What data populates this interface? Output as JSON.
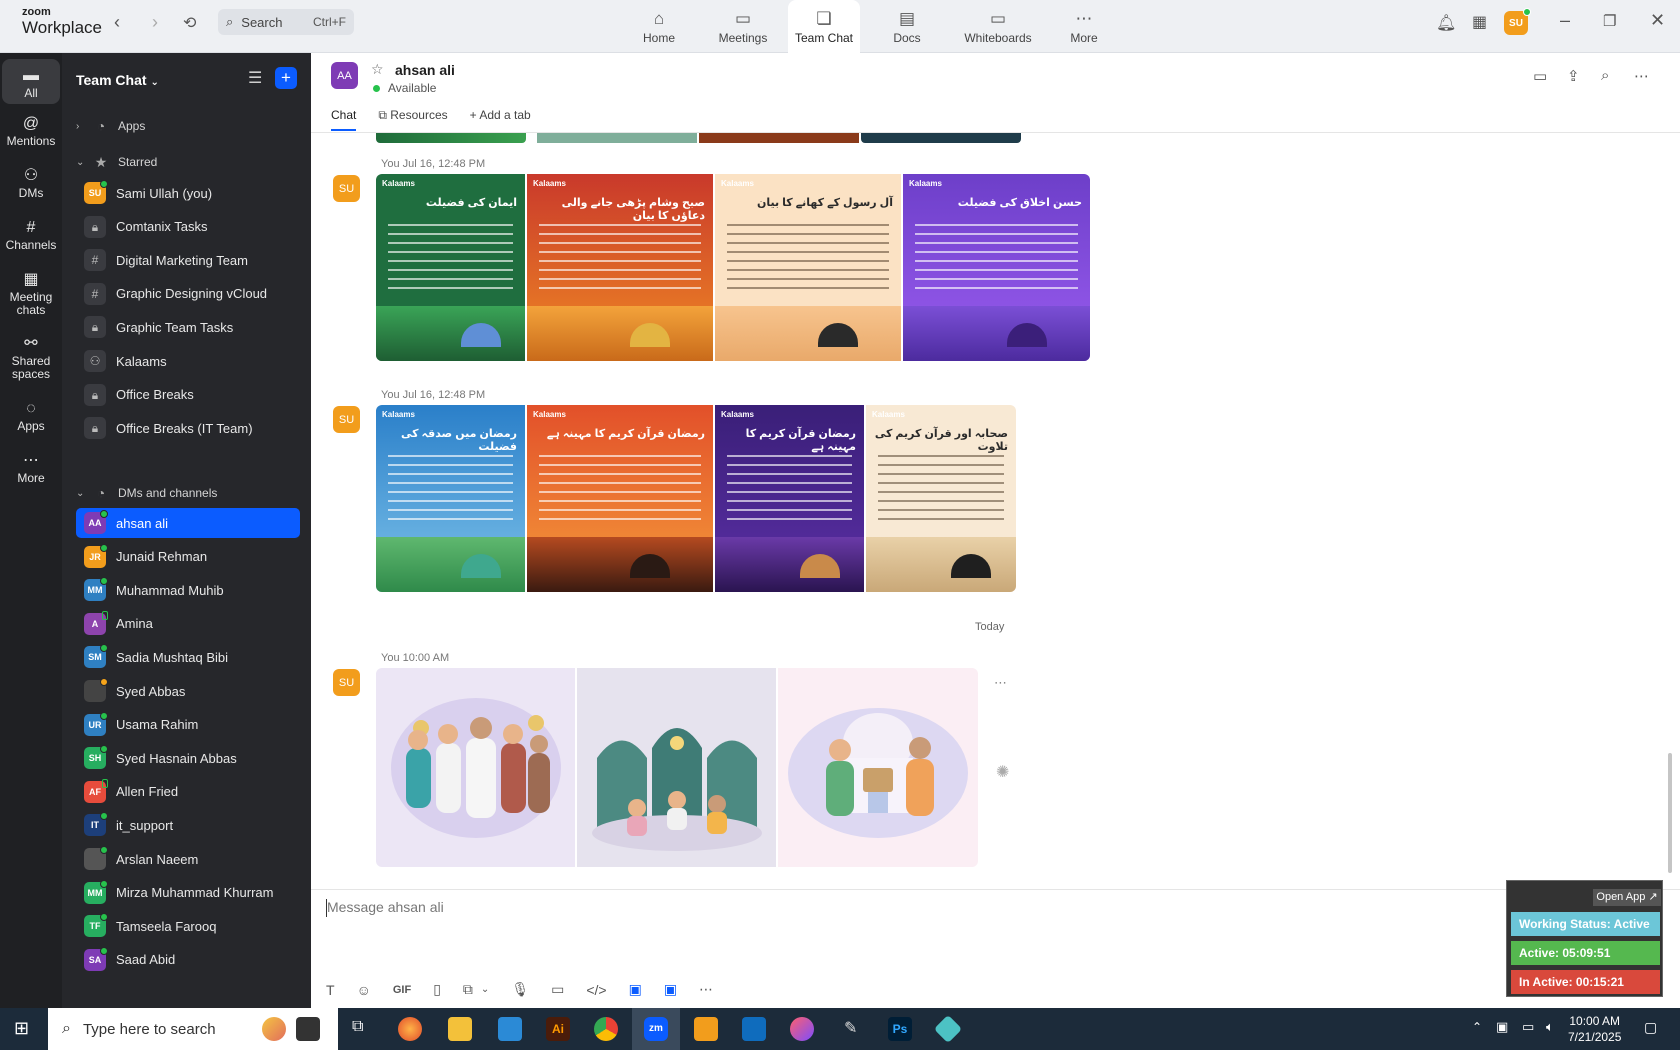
{
  "titlebar": {
    "brand_top": "zoom",
    "brand_bottom": "Workplace",
    "search_placeholder": "Search",
    "search_shortcut": "Ctrl+F",
    "nav": [
      {
        "label": "Home",
        "icon": "home-icon"
      },
      {
        "label": "Meetings",
        "icon": "video-icon"
      },
      {
        "label": "Team Chat",
        "icon": "chat-icon"
      },
      {
        "label": "Docs",
        "icon": "doc-icon"
      },
      {
        "label": "Whiteboards",
        "icon": "whiteboard-icon"
      },
      {
        "label": "More",
        "icon": "more-icon"
      }
    ],
    "user_initials": "SU"
  },
  "rail": [
    {
      "label": "All"
    },
    {
      "label": "Mentions"
    },
    {
      "label": "DMs"
    },
    {
      "label": "Channels"
    },
    {
      "label": "Meeting chats"
    },
    {
      "label": "Shared spaces"
    },
    {
      "label": "Apps"
    },
    {
      "label": "More"
    }
  ],
  "sidebar": {
    "title": "Team Chat",
    "apps_label": "Apps",
    "starred_label": "Starred",
    "starred": [
      {
        "name": "Sami Ullah (you)",
        "initials": "SU",
        "kind": "person",
        "color": "#f29d1c"
      },
      {
        "name": "Comtanix Tasks",
        "kind": "lock"
      },
      {
        "name": "Digital Marketing Team",
        "kind": "hash"
      },
      {
        "name": "Graphic Designing vCloud",
        "kind": "hash"
      },
      {
        "name": "Graphic Team Tasks",
        "kind": "lock"
      },
      {
        "name": "Kalaams",
        "kind": "group"
      },
      {
        "name": "Office Breaks",
        "kind": "lock"
      },
      {
        "name": "Office Breaks (IT Team)",
        "kind": "lock"
      }
    ],
    "dms_label": "DMs and channels",
    "dms": [
      {
        "name": "ahsan ali",
        "initials": "AA",
        "color": "#7e3bb5"
      },
      {
        "name": "Junaid Rehman",
        "initials": "JR",
        "color": "#f29d1c"
      },
      {
        "name": "Muhammad Muhib",
        "initials": "MM",
        "color": "#2f80c2"
      },
      {
        "name": "Amina",
        "initials": "A",
        "color": "#8e44ad"
      },
      {
        "name": "Sadia Mushtaq Bibi",
        "initials": "SM",
        "color": "#2f80c2"
      },
      {
        "name": "Syed Abbas",
        "initials": "",
        "color": "#444"
      },
      {
        "name": "Usama Rahim",
        "initials": "UR",
        "color": "#2f80c2"
      },
      {
        "name": "Syed Hasnain Abbas",
        "initials": "SH",
        "color": "#27ae60"
      },
      {
        "name": "Allen Fried",
        "initials": "AF",
        "color": "#e74c3c"
      },
      {
        "name": "it_support",
        "initials": "IT",
        "color": "#1d3f7a"
      },
      {
        "name": "Arslan Naeem",
        "initials": "",
        "color": "#555"
      },
      {
        "name": "Mirza Muhammad Khurram",
        "initials": "MM",
        "color": "#27ae60"
      },
      {
        "name": "Tamseela Farooq",
        "initials": "TF",
        "color": "#27ae60"
      },
      {
        "name": "Saad Abid",
        "initials": "SA",
        "color": "#7e3bb5"
      }
    ]
  },
  "chat": {
    "contact_initials": "AA",
    "contact_name": "ahsan ali",
    "contact_status": "Available",
    "tabs": [
      "Chat",
      "Resources",
      "Add a tab"
    ],
    "messages": [
      {
        "sender": "You",
        "time": "Jul 16, 12:48 PM",
        "avatar": "SU"
      },
      {
        "sender": "You",
        "time": "Jul 16, 12:48 PM",
        "avatar": "SU"
      },
      {
        "sender": "You",
        "time": "10:00 AM",
        "avatar": "SU"
      }
    ],
    "row1_cards": [
      {
        "logo": "Kalaams",
        "title": "ایمان کی فضیلت"
      },
      {
        "logo": "Kalaams",
        "title": "صبح وشام پڑھی جانے والی دعاؤں کا بیان"
      },
      {
        "logo": "Kalaams",
        "title": "آل رسول کے کھانے کا بیان"
      },
      {
        "logo": "Kalaams",
        "title": "حسن اخلاق کی فضیلت"
      }
    ],
    "row2_cards": [
      {
        "logo": "Kalaams",
        "title": "رمضان میں صدقہ کی فضیلت"
      },
      {
        "logo": "Kalaams",
        "title": "رمضان قرآن کریم کا مہینہ ہے"
      },
      {
        "logo": "Kalaams",
        "title": "رمضان قرآن کریم کا مہینہ ہے"
      },
      {
        "logo": "Kalaams",
        "title": "صحابہ اور قرآن کریم کی تلاوت"
      }
    ],
    "today_label": "Today",
    "compose_placeholder": "Message ahsan ali"
  },
  "widget": {
    "open_app": "Open App ↗",
    "working_status": "Working Status: Active",
    "active": "Active: 05:09:51",
    "inactive": "In Active: 00:15:21"
  },
  "taskbar": {
    "search_placeholder": "Type here to search",
    "time": "10:00 AM",
    "date": "7/21/2025"
  },
  "colors": {
    "accent": "#0b5cff",
    "sidebar_bg": "#26272b",
    "rail_bg": "#1f2023",
    "online": "#27c24c"
  }
}
